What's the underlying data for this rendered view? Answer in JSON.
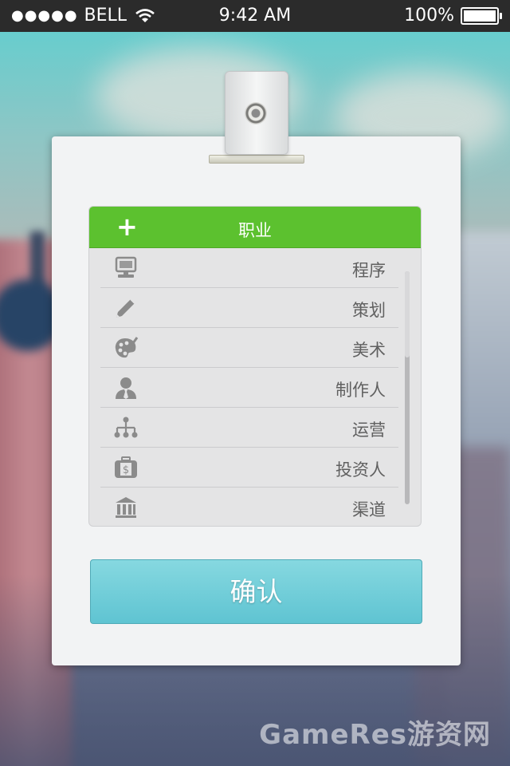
{
  "status_bar": {
    "signal": "●●●●●",
    "carrier": "BELL",
    "time": "9:42 AM",
    "battery": "100%"
  },
  "panel": {
    "title": "职业",
    "add_icon": "plus-icon",
    "items": [
      {
        "label": "程序",
        "icon": "computer-icon"
      },
      {
        "label": "策划",
        "icon": "pen-icon"
      },
      {
        "label": "美术",
        "icon": "palette-icon"
      },
      {
        "label": "制作人",
        "icon": "person-tie-icon"
      },
      {
        "label": "运营",
        "icon": "org-chart-icon"
      },
      {
        "label": "投资人",
        "icon": "briefcase-dollar-icon"
      },
      {
        "label": "渠道",
        "icon": "bank-icon"
      }
    ]
  },
  "confirm_label": "确认",
  "watermark": "GameRes游资网",
  "colors": {
    "header_green": "#5cc12f",
    "confirm_blue": "#6ccbd8",
    "status_bar": "#2b2b2b"
  }
}
